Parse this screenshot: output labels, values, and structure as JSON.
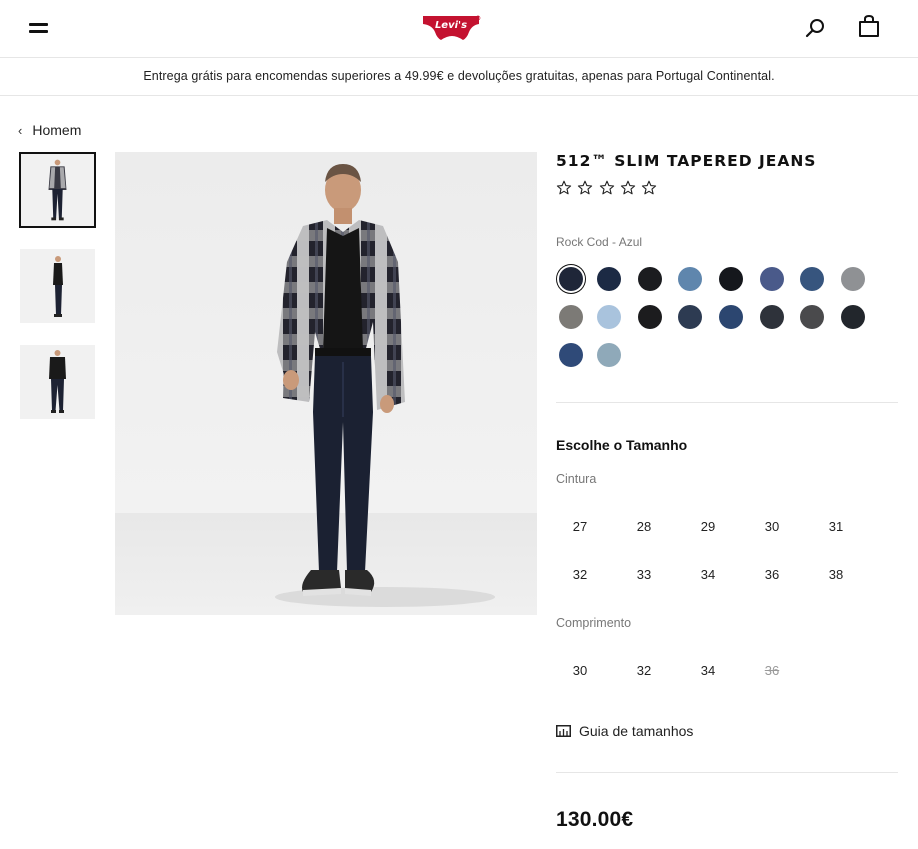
{
  "header": {
    "brand": "Levi's",
    "brand_color": "#c41230"
  },
  "promo": {
    "text": "Entrega grátis para encomendas superiores a 49.99€ e devoluções gratuitas, apenas para Portugal Continental."
  },
  "breadcrumb": {
    "label": "Homem"
  },
  "gallery": {
    "thumbnails": [
      {
        "name": "front-view",
        "active": true
      },
      {
        "name": "side-view",
        "active": false
      },
      {
        "name": "back-view",
        "active": false
      }
    ]
  },
  "product": {
    "title": "512™ SLIM TAPERED JEANS",
    "rating_stars": 5,
    "rating_value": 0,
    "color_name": "Rock Cod - Azul",
    "swatches": [
      "#1f2638",
      "#1c2a44",
      "#1b1c1f",
      "#5f86ad",
      "#15171c",
      "#4a5a8a",
      "#37557e",
      "#8f9194",
      "#7c7a76",
      "#a9c3dd",
      "#1c1c1e",
      "#2d3b52",
      "#2c4670",
      "#2e323a",
      "#4a4a4c",
      "#22262c",
      "#2f4a78",
      "#8fa9b9"
    ],
    "selected_swatch_index": 0,
    "size_heading": "Escolhe o Tamanho",
    "waist_label": "Cintura",
    "waist_sizes": [
      "27",
      "28",
      "29",
      "30",
      "31",
      "32",
      "33",
      "34",
      "36",
      "38"
    ],
    "length_label": "Comprimento",
    "length_sizes": [
      {
        "value": "30",
        "available": true
      },
      {
        "value": "32",
        "available": true
      },
      {
        "value": "34",
        "available": true
      },
      {
        "value": "36",
        "available": false
      }
    ],
    "size_guide_label": "Guia de tamanhos",
    "price": "130.00€"
  }
}
